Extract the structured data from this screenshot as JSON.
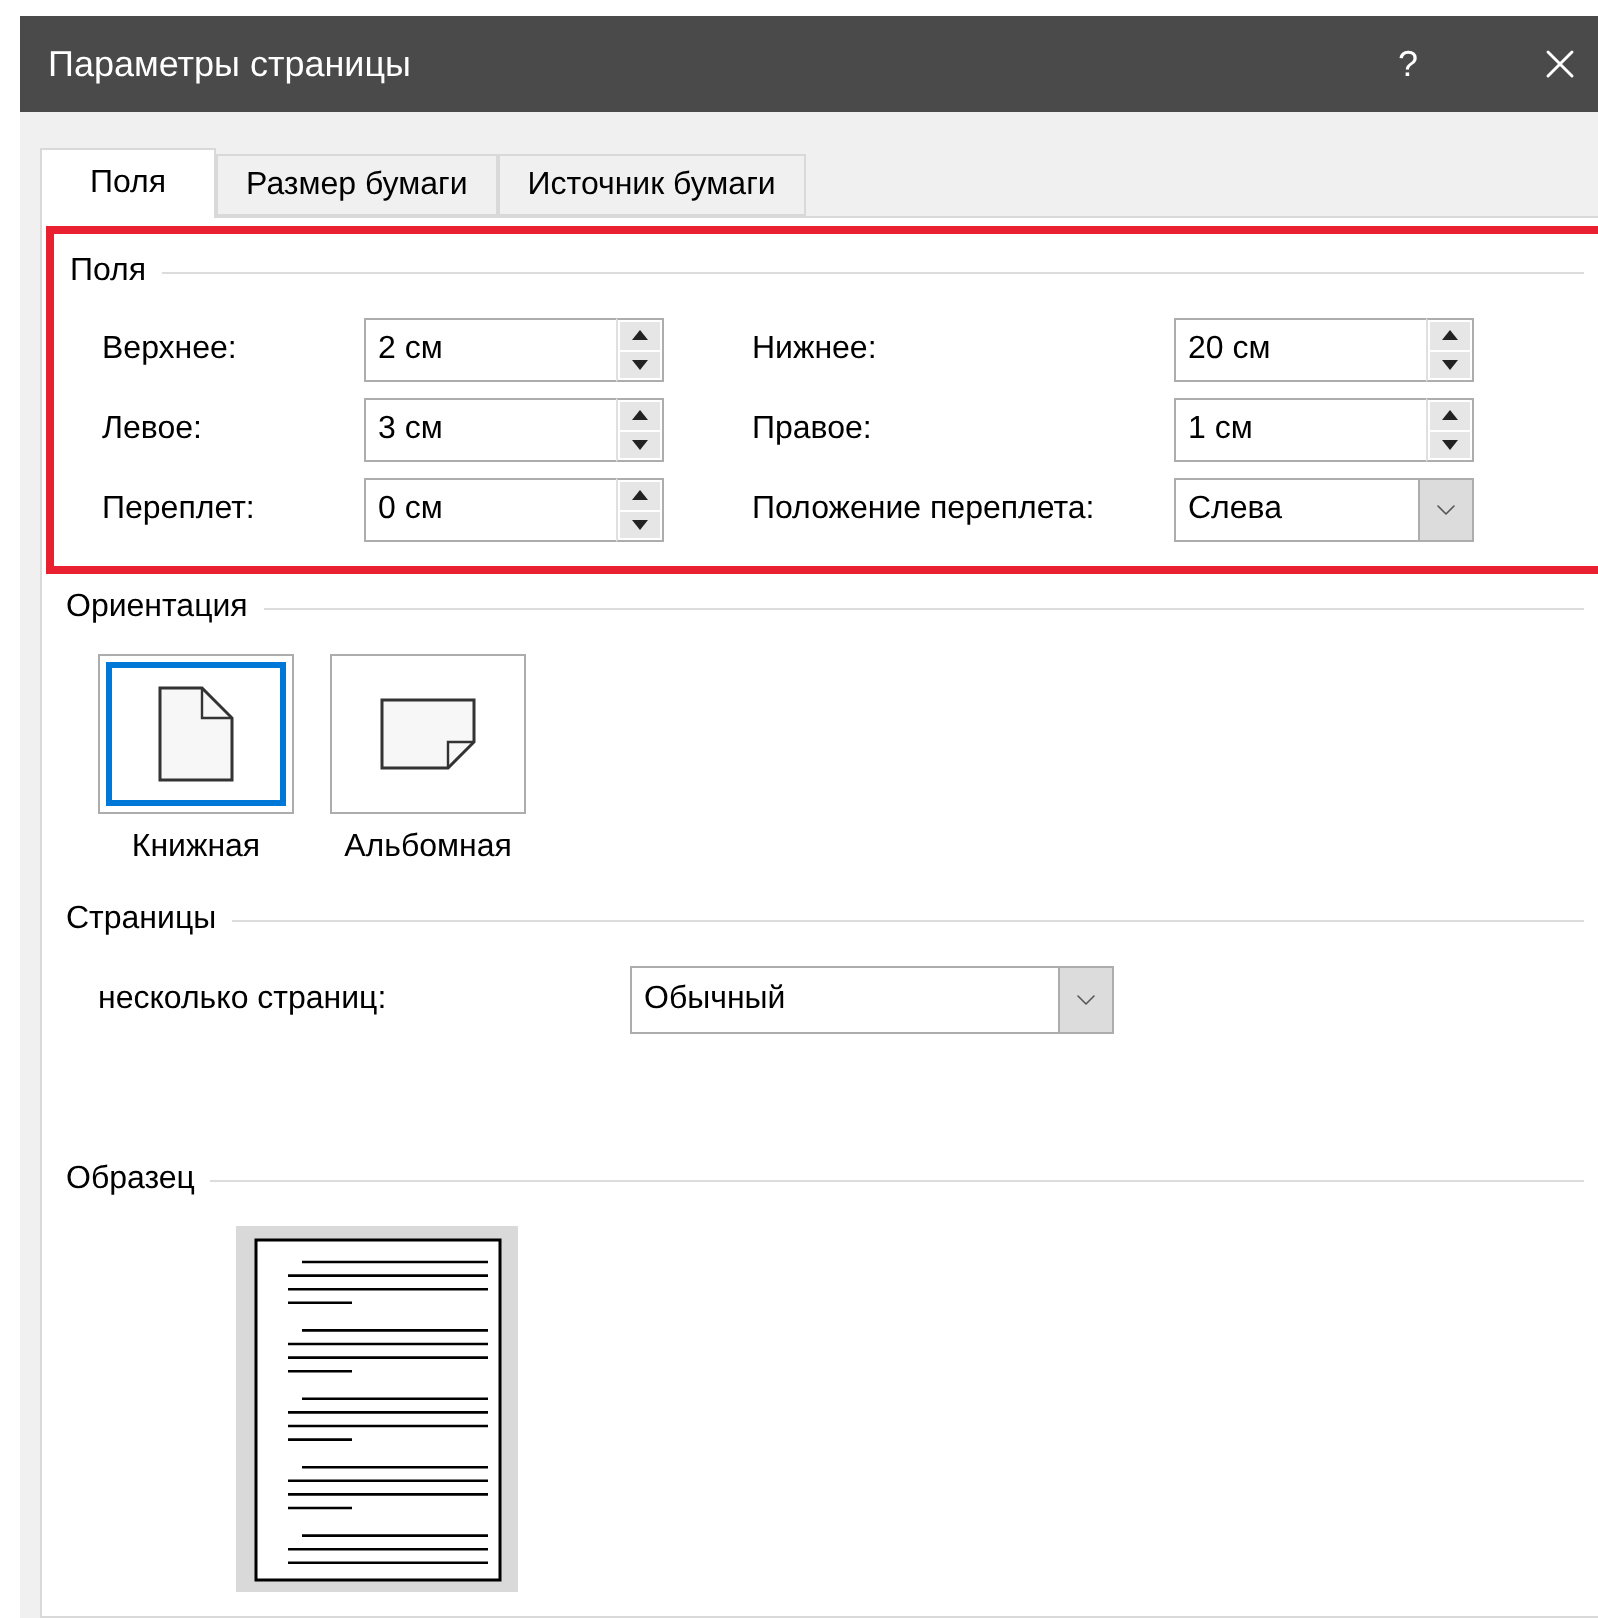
{
  "window": {
    "title": "Параметры страницы",
    "help_button": "?"
  },
  "tabs": [
    {
      "label": "Поля",
      "selected": true
    },
    {
      "label": "Размер бумаги",
      "selected": false
    },
    {
      "label": "Источник бумаги",
      "selected": false
    }
  ],
  "margins": {
    "title": "Поля",
    "highlighted": true,
    "fields": [
      {
        "kind": "spinner",
        "label": "Верхнее:",
        "value": "2 см"
      },
      {
        "kind": "spinner",
        "label": "Нижнее:",
        "value": "20 см"
      },
      {
        "kind": "spinner",
        "label": "Левое:",
        "value": "3 см"
      },
      {
        "kind": "spinner",
        "label": "Правое:",
        "value": "1 см"
      },
      {
        "kind": "spinner",
        "label": "Переплет:",
        "value": "0 см"
      },
      {
        "kind": "dropdown",
        "label": "Положение переплета:",
        "value": "Слева"
      }
    ]
  },
  "orientation": {
    "title": "Ориентация",
    "options": [
      {
        "kind": "portrait",
        "label": "Книжная",
        "selected": true
      },
      {
        "kind": "landscape",
        "label": "Альбомная",
        "selected": false
      }
    ]
  },
  "pages": {
    "title": "Страницы",
    "label": "несколько страниц:",
    "value": "Обычный"
  },
  "preview": {
    "title": "Образец"
  }
}
